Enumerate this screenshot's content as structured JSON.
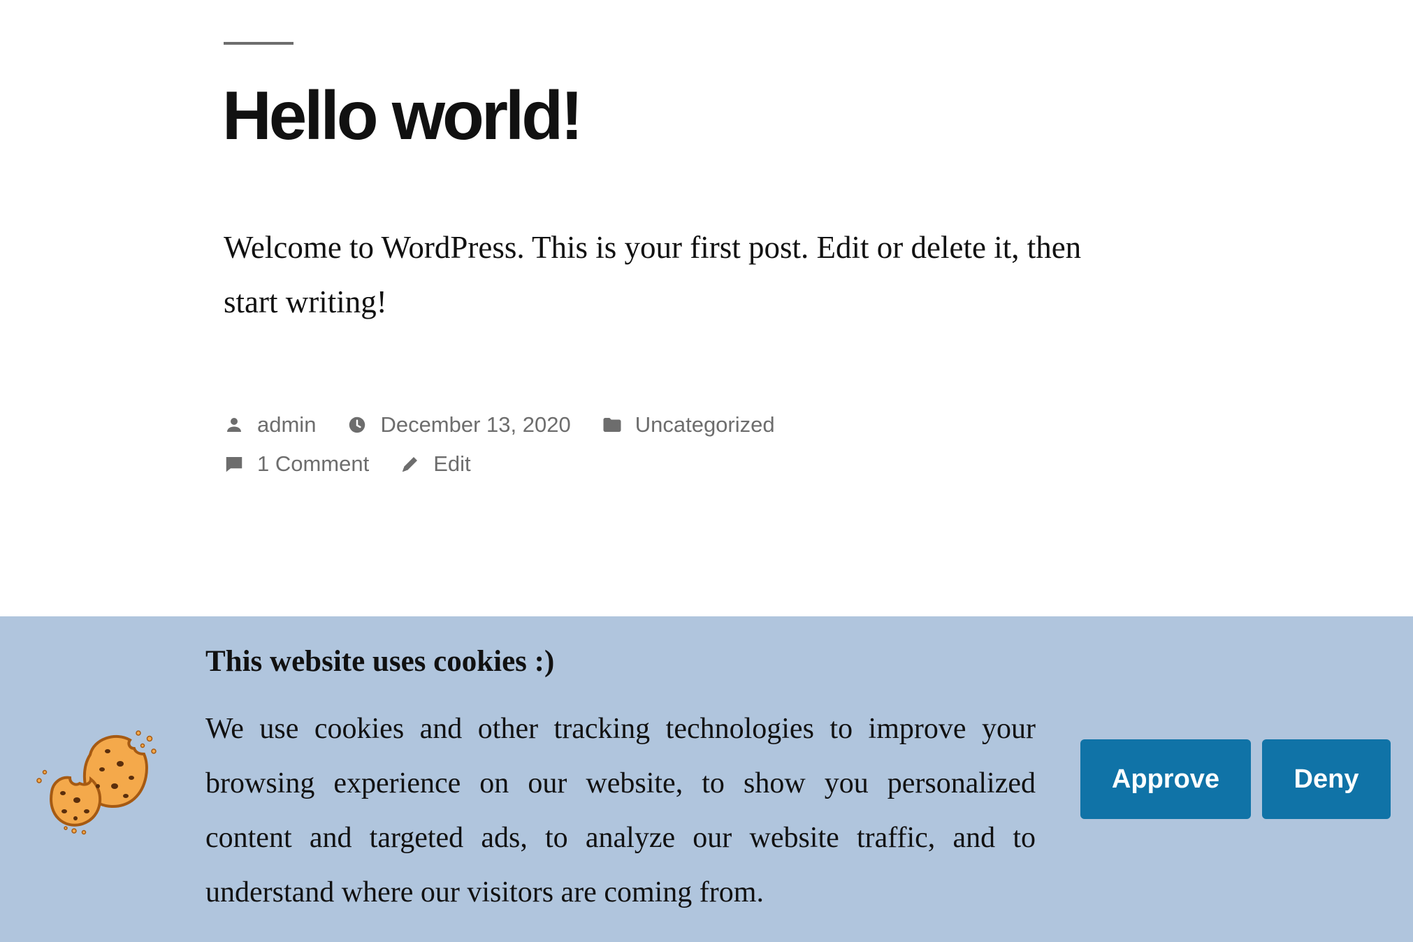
{
  "post": {
    "title": "Hello world!",
    "content": "Welcome to WordPress. This is your first post. Edit or delete it, then start writing!",
    "meta": {
      "author": "admin",
      "date": "December 13, 2020",
      "category": "Uncategorized",
      "comments": "1 Comment",
      "edit": "Edit"
    }
  },
  "cookie_banner": {
    "heading": "This website uses cookies :)",
    "text": "We use cookies and other tracking technologies to improve your browsing experience on our website, to show you personalized content and targeted ads, to analyze our website traffic, and to understand where our visitors are coming from.",
    "approve_label": "Approve",
    "deny_label": "Deny",
    "icon": "cookie-icon"
  },
  "colors": {
    "banner_background": "#b0c5dd",
    "button_background": "#1073a7",
    "button_text": "#ffffff",
    "meta_text": "#6d6d6d",
    "body_text": "#111111"
  },
  "icons": {
    "author": "person-icon",
    "date": "clock-icon",
    "category": "folder-icon",
    "comments": "comment-icon",
    "edit": "pencil-icon"
  }
}
